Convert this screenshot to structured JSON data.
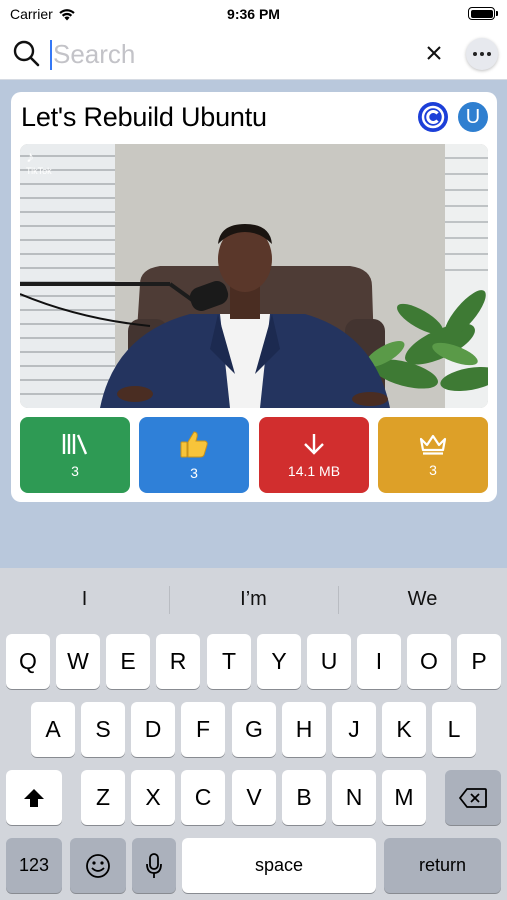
{
  "status_bar": {
    "carrier": "Carrier",
    "time": "9:36 PM"
  },
  "search": {
    "placeholder": "Search",
    "value": ""
  },
  "card": {
    "title": "Let's Rebuild Ubuntu",
    "avatar_letter": "U",
    "video_watermark": "TikTok",
    "actions": [
      {
        "icon": "library-icon",
        "label": "3",
        "color": "#2e9a54"
      },
      {
        "icon": "thumbs-up-icon",
        "label": "3",
        "color": "#2f80d8"
      },
      {
        "icon": "download-arrow-icon",
        "label": "14.1 MB",
        "color": "#d12e2e"
      },
      {
        "icon": "crown-icon",
        "label": "3",
        "color": "#dda028"
      }
    ]
  },
  "keyboard": {
    "suggestions": [
      "I",
      "I’m",
      "We"
    ],
    "row1": [
      "Q",
      "W",
      "E",
      "R",
      "T",
      "Y",
      "U",
      "I",
      "O",
      "P"
    ],
    "row2": [
      "A",
      "S",
      "D",
      "F",
      "G",
      "H",
      "J",
      "K",
      "L"
    ],
    "row3": [
      "Z",
      "X",
      "C",
      "V",
      "B",
      "N",
      "M"
    ],
    "numbers_key": "123",
    "space_key": "space",
    "return_key": "return"
  }
}
